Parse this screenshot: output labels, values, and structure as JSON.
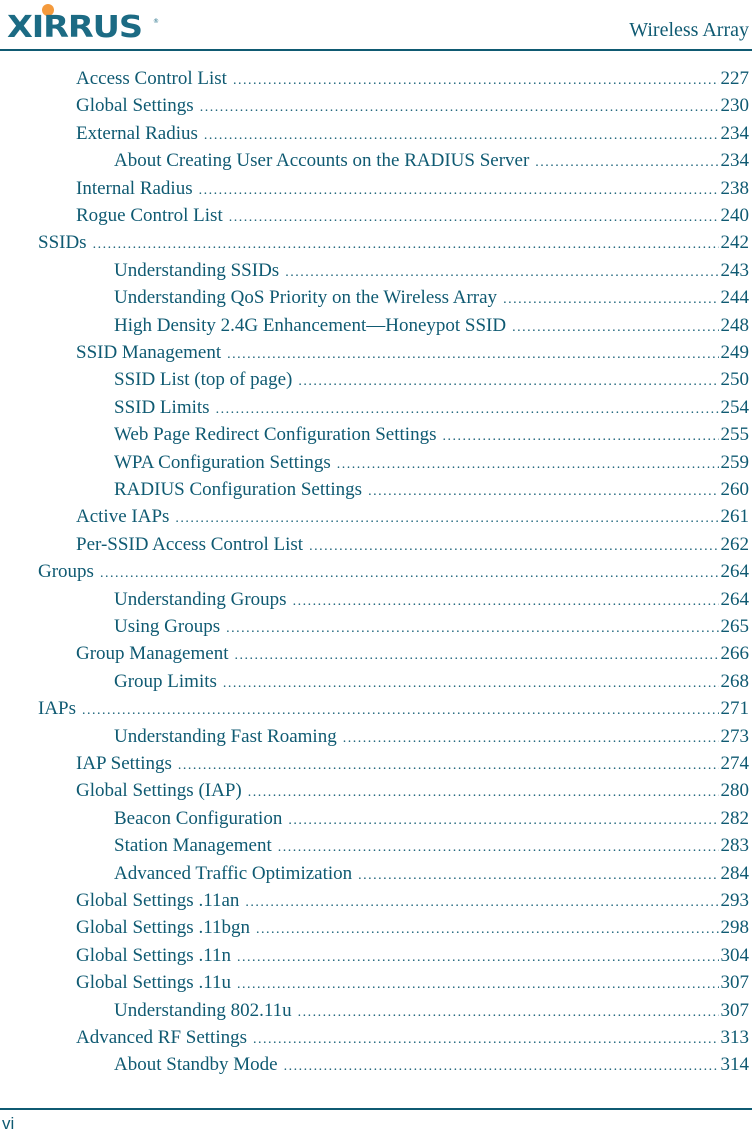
{
  "header": {
    "logo_text": "XIRRUS",
    "logo_icon": "xirrus-logo-icon",
    "title": "Wireless Array"
  },
  "colors": {
    "text": "#0f5a72",
    "rule": "#0f5a72",
    "logo_blue": "#1c6b84",
    "logo_orange": "#f49a3c"
  },
  "toc": [
    {
      "level": 2,
      "title": "Access Control List",
      "page": "227"
    },
    {
      "level": 2,
      "title": "Global Settings",
      "page": "230"
    },
    {
      "level": 2,
      "title": "External Radius",
      "page": "234"
    },
    {
      "level": 3,
      "title": "About Creating User Accounts on the RADIUS Server",
      "page": "234"
    },
    {
      "level": 2,
      "title": "Internal Radius",
      "page": "238"
    },
    {
      "level": 2,
      "title": "Rogue Control List",
      "page": "240"
    },
    {
      "level": 1,
      "title": "SSIDs",
      "page": "242"
    },
    {
      "level": 3,
      "title": "Understanding SSIDs",
      "page": "243"
    },
    {
      "level": 3,
      "title": "Understanding QoS Priority on the Wireless Array",
      "page": "244"
    },
    {
      "level": 3,
      "title": "High Density 2.4G Enhancement—Honeypot SSID",
      "page": "248"
    },
    {
      "level": 2,
      "title": "SSID Management",
      "page": "249"
    },
    {
      "level": 3,
      "title": "SSID List (top of page)",
      "page": "250"
    },
    {
      "level": 3,
      "title": "SSID Limits",
      "page": "254"
    },
    {
      "level": 3,
      "title": "Web Page Redirect Configuration Settings",
      "page": "255"
    },
    {
      "level": 3,
      "title": "WPA Configuration Settings",
      "page": "259"
    },
    {
      "level": 3,
      "title": "RADIUS Configuration Settings",
      "page": "260"
    },
    {
      "level": 2,
      "title": "Active IAPs",
      "page": "261"
    },
    {
      "level": 2,
      "title": "Per-SSID Access Control List",
      "page": "262"
    },
    {
      "level": 1,
      "title": "Groups",
      "page": "264"
    },
    {
      "level": 3,
      "title": "Understanding Groups",
      "page": "264"
    },
    {
      "level": 3,
      "title": "Using Groups",
      "page": "265"
    },
    {
      "level": 2,
      "title": "Group Management",
      "page": "266"
    },
    {
      "level": 3,
      "title": "Group Limits",
      "page": "268"
    },
    {
      "level": 1,
      "title": "IAPs",
      "page": "271"
    },
    {
      "level": 3,
      "title": "Understanding Fast Roaming",
      "page": "273"
    },
    {
      "level": 2,
      "title": "IAP Settings",
      "page": "274"
    },
    {
      "level": 2,
      "title": "Global Settings (IAP)",
      "page": "280"
    },
    {
      "level": 3,
      "title": "Beacon Configuration",
      "page": "282"
    },
    {
      "level": 3,
      "title": "Station Management",
      "page": "283"
    },
    {
      "level": 3,
      "title": "Advanced Traffic Optimization",
      "page": "284"
    },
    {
      "level": 2,
      "title": "Global Settings .11an",
      "page": "293"
    },
    {
      "level": 2,
      "title": "Global Settings .11bgn",
      "page": "298"
    },
    {
      "level": 2,
      "title": "Global Settings .11n",
      "page": "304"
    },
    {
      "level": 2,
      "title": "Global Settings .11u",
      "page": "307"
    },
    {
      "level": 3,
      "title": "Understanding 802.11u",
      "page": "307"
    },
    {
      "level": 2,
      "title": "Advanced RF Settings",
      "page": "313"
    },
    {
      "level": 3,
      "title": "About Standby Mode",
      "page": "314"
    }
  ],
  "footer": {
    "page_number": "vi"
  }
}
